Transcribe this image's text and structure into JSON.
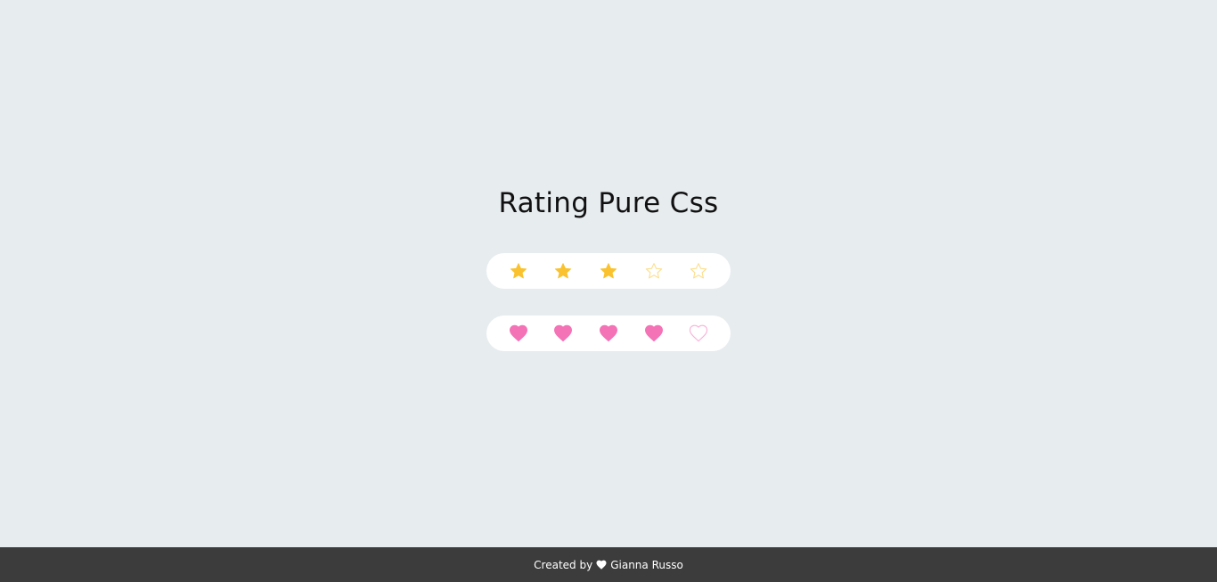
{
  "title": "Rating Pure Css",
  "star_rating": {
    "value": 3,
    "max": 5,
    "icon": "star-icon",
    "color": "#f9c22e",
    "empty_color": "#f9c22e"
  },
  "heart_rating": {
    "value": 4,
    "max": 5,
    "icon": "heart-icon",
    "color": "#f472b6",
    "empty_color": "#f472b6"
  },
  "footer": {
    "prefix": "Created by",
    "author": "Gianna Russo",
    "icon": "heart-icon"
  },
  "colors": {
    "background": "#e7ecef",
    "footer_background": "#3c3c3c"
  }
}
